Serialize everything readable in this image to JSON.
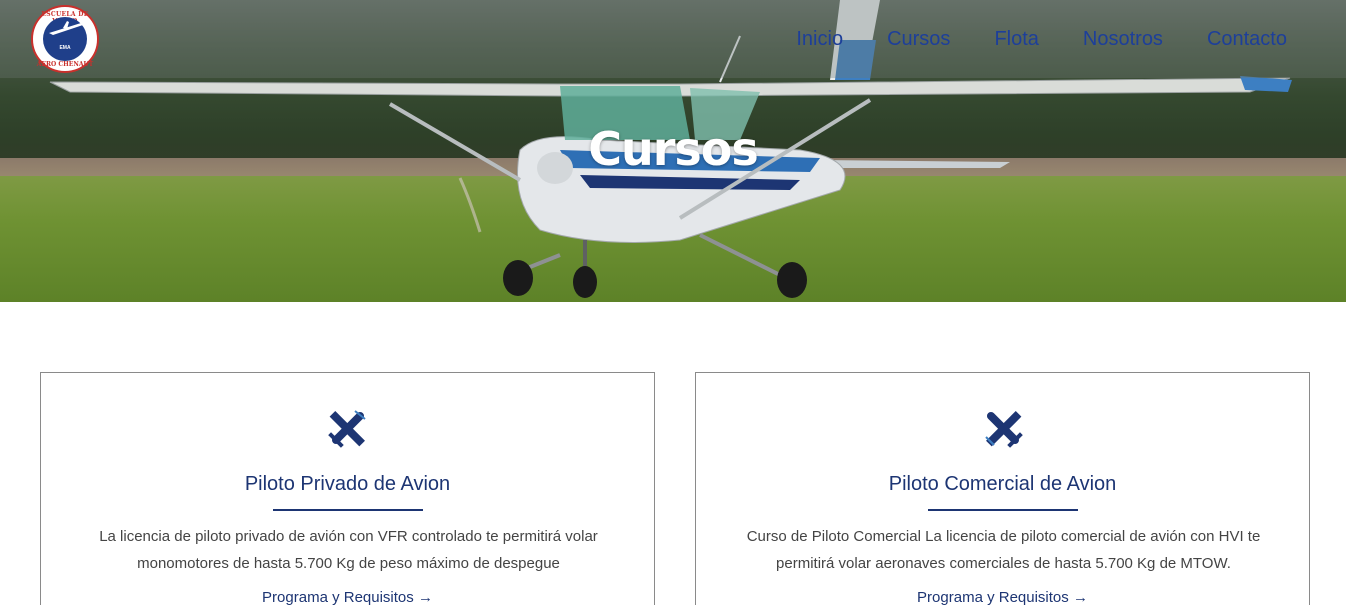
{
  "logo": {
    "text_top": "ESCUELA DE VUELO",
    "text_bottom": "AERO CHENAUT",
    "mark": "EMA"
  },
  "nav": {
    "items": [
      {
        "label": "Inicio"
      },
      {
        "label": "Cursos"
      },
      {
        "label": "Flota"
      },
      {
        "label": "Nosotros"
      },
      {
        "label": "Contacto"
      }
    ]
  },
  "hero": {
    "title": "Cursos"
  },
  "cards": [
    {
      "icon": "airplane-icon",
      "title": "Piloto Privado de Avion",
      "description": "La licencia de piloto privado de avión con VFR controlado te permitirá volar monomotores de hasta 5.700 Kg de peso máximo de despegue",
      "link_label": "Programa y Requisitos",
      "link_arrow": "→"
    },
    {
      "icon": "airplane-icon",
      "title": "Piloto Comercial de Avion",
      "description": "Curso de Piloto Comercial La licencia de piloto comercial de avión con HVI te permitirá volar aeronaves comerciales de hasta 5.700 Kg de MTOW.",
      "link_label": "Programa y Requisitos",
      "link_arrow": "→"
    }
  ],
  "colors": {
    "accent": "#1d3573",
    "nav_link": "#1d3f9a",
    "logo_red": "#c9302c",
    "logo_blue": "#1f3f8a"
  }
}
